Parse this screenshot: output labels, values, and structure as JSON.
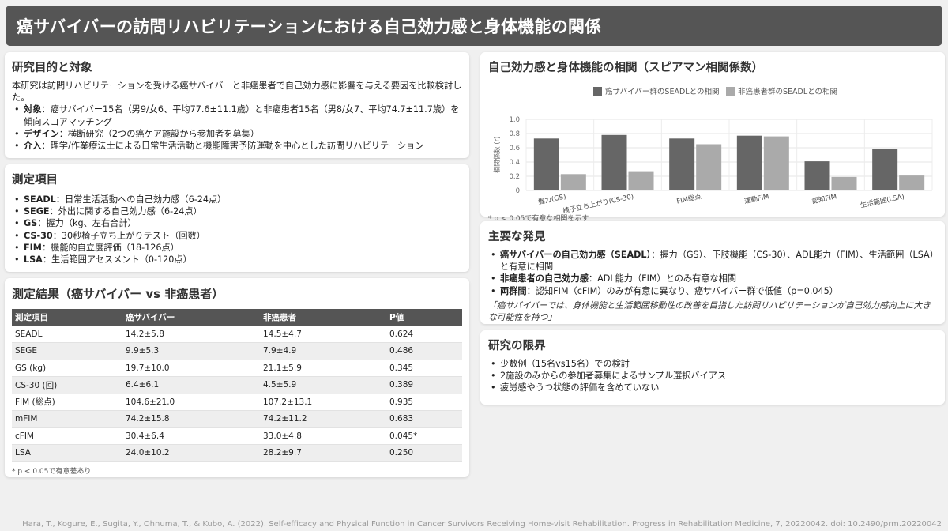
{
  "title": "癌サバイバーの訪問リハビリテーションにおける自己効力感と身体機能の関係",
  "purpose": {
    "heading": "研究目的と対象",
    "intro": "本研究は訪問リハビリテーションを受ける癌サバイバーと非癌患者で自己効力感に影響を与える要因を比較検討した。",
    "items": [
      {
        "label": "対象",
        "text": "：癌サバイバー15名（男9/女6、平均77.6±11.1歳）と非癌患者15名（男8/女7、平均74.7±11.7歳）を傾向スコアマッチング"
      },
      {
        "label": "デザイン",
        "text": "：横断研究（2つの癌ケア施設から参加者を募集）"
      },
      {
        "label": "介入",
        "text": "：理学/作業療法士による日常生活活動と機能障害予防運動を中心とした訪問リハビリテーション"
      }
    ]
  },
  "measures": {
    "heading": "測定項目",
    "items": [
      {
        "label": "SEADL",
        "text": "：日常生活活動への自己効力感（6-24点）"
      },
      {
        "label": "SEGE",
        "text": "：外出に関する自己効力感（6-24点）"
      },
      {
        "label": "GS",
        "text": "：握力（kg、左右合計）"
      },
      {
        "label": "CS-30",
        "text": "：30秒椅子立ち上がりテスト（回数）"
      },
      {
        "label": "FIM",
        "text": "：機能的自立度評価（18-126点）"
      },
      {
        "label": "LSA",
        "text": "：生活範囲アセスメント（0-120点）"
      }
    ]
  },
  "results": {
    "heading": "測定結果（癌サバイバー vs 非癌患者）",
    "columns": [
      "測定項目",
      "癌サバイバー",
      "非癌患者",
      "P値"
    ],
    "rows": [
      [
        "SEADL",
        "14.2±5.8",
        "14.5±4.7",
        "0.624"
      ],
      [
        "SEGE",
        "9.9±5.3",
        "7.9±4.9",
        "0.486"
      ],
      [
        "GS (kg)",
        "19.7±10.0",
        "21.1±5.9",
        "0.345"
      ],
      [
        "CS-30 (回)",
        "6.4±6.1",
        "4.5±5.9",
        "0.389"
      ],
      [
        "FIM (総点)",
        "104.6±21.0",
        "107.2±13.1",
        "0.935"
      ],
      [
        "mFIM",
        "74.2±15.8",
        "74.2±11.2",
        "0.683"
      ],
      [
        "cFIM",
        "30.4±6.4",
        "33.0±4.8",
        "0.045*"
      ],
      [
        "LSA",
        "24.0±10.2",
        "28.2±9.7",
        "0.250"
      ]
    ],
    "note": "* p < 0.05で有意差あり"
  },
  "chart_section": {
    "heading": "自己効力感と身体機能の相関（スピアマン相関係数）",
    "note": "* p < 0.05で有意な相関を示す"
  },
  "chart_data": {
    "type": "bar",
    "categories": [
      "握力(GS)",
      "椅子立ち上がり(CS-30)",
      "FIM総点",
      "運動FIM",
      "認知FIM",
      "生活範囲(LSA)"
    ],
    "series": [
      {
        "name": "癌サバイバー群のSEADLとの相関",
        "values": [
          0.73,
          0.78,
          0.73,
          0.77,
          0.41,
          0.58
        ],
        "color": "#666666"
      },
      {
        "name": "非癌患者群のSEADLとの相関",
        "values": [
          0.23,
          0.26,
          0.65,
          0.76,
          0.19,
          0.21
        ],
        "color": "#aaaaaa"
      }
    ],
    "ylabel": "相関係数 (r)",
    "ylim": [
      0,
      1.0
    ],
    "yticks": [
      "0",
      "0.2",
      "0.4",
      "0.6",
      "0.8",
      "1.0"
    ],
    "grid": true,
    "legend": "top"
  },
  "findings": {
    "heading": "主要な発見",
    "items": [
      {
        "label": "癌サバイバーの自己効力感（SEADL）",
        "text": "：握力（GS）、下肢機能（CS-30）、ADL能力（FIM）、生活範囲（LSA）と有意に相関"
      },
      {
        "label": "非癌患者の自己効力感",
        "text": "：ADL能力（FIM）とのみ有意な相関"
      },
      {
        "label": "両群間",
        "text": "：認知FIM（cFIM）のみが有意に異なり、癌サバイバー群で低値（p=0.045）"
      }
    ],
    "quote": "「癌サバイバーでは、身体機能と生活範囲移動性の改善を目指した訪問リハビリテーションが自己効力感向上に大きな可能性を持つ」"
  },
  "limits": {
    "heading": "研究の限界",
    "items": [
      "少数例（15名vs15名）での検討",
      "2施設のみからの参加者募集によるサンプル選択バイアス",
      "疲労感やうつ状態の評価を含めていない"
    ]
  },
  "citation": "Hara, T., Kogure, E., Sugita, Y., Ohnuma, T., & Kubo, A. (2022). Self-efficacy and Physical Function in Cancer Survivors Receiving Home-visit Rehabilitation. Progress in Rehabilitation Medicine, 7, 20220042. doi: 10.2490/prm.20220042"
}
